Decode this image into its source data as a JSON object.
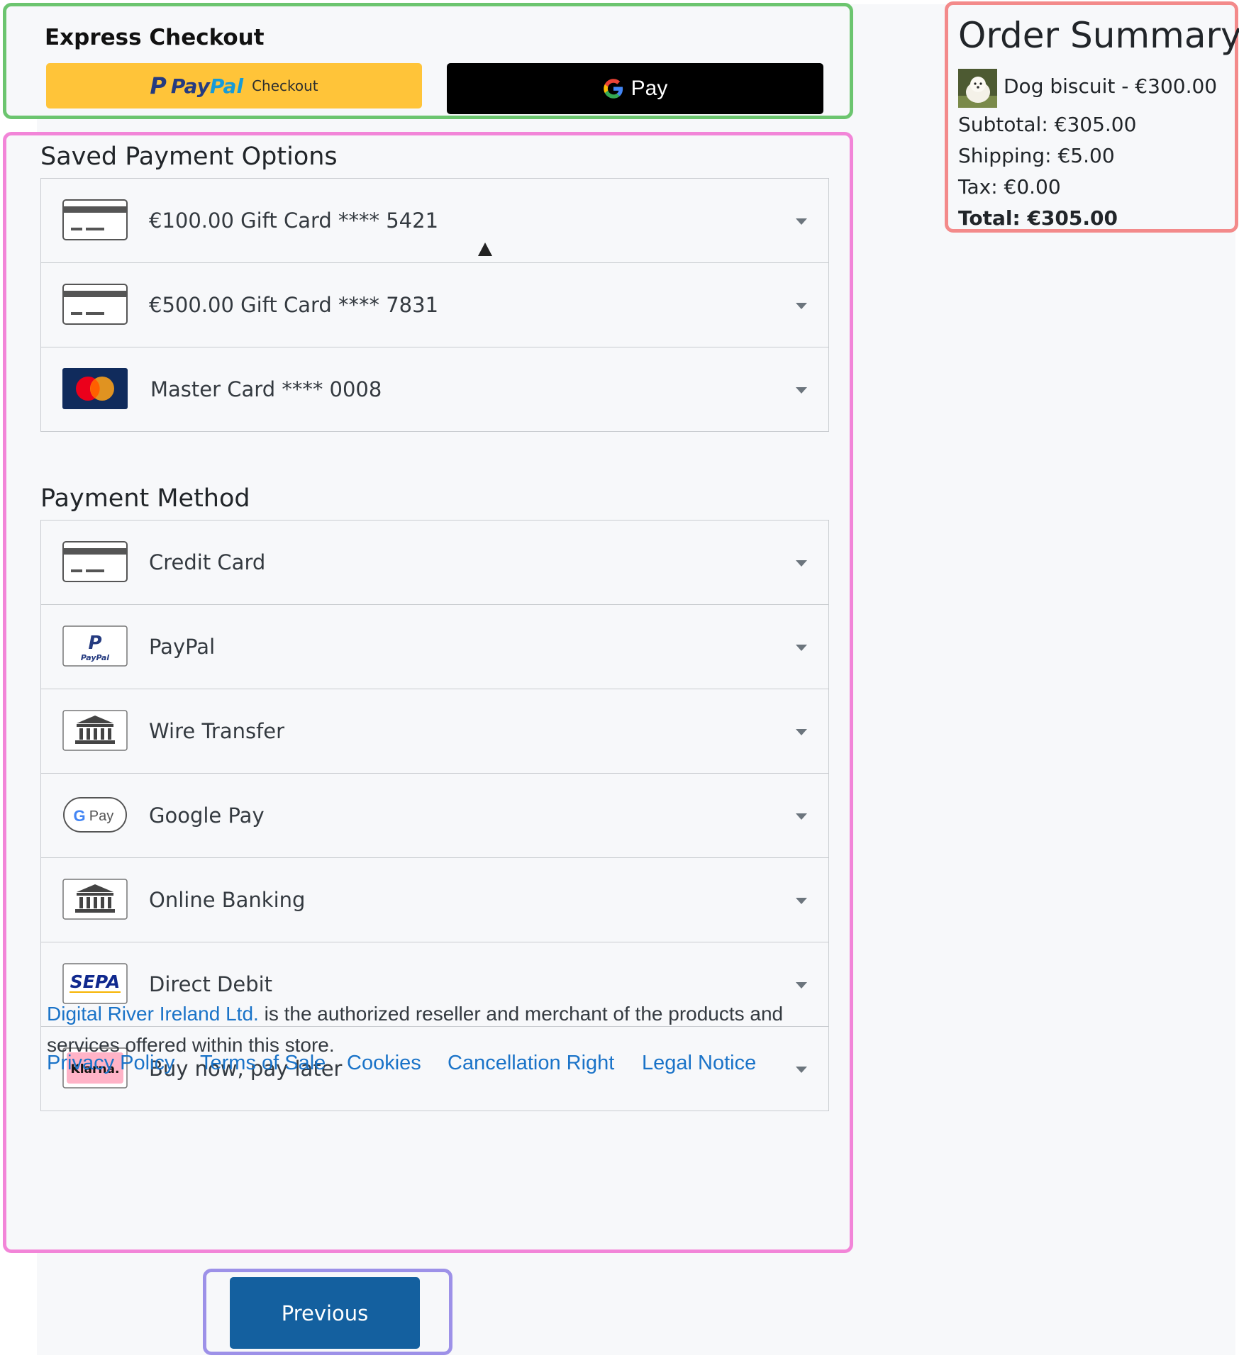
{
  "express": {
    "title": "Express Checkout",
    "paypal_p": "P",
    "paypal_pay": "Pay",
    "paypal_pal": "Pal",
    "paypal_checkout": "Checkout",
    "gpay_label": "Pay"
  },
  "saved": {
    "title": "Saved Payment Options",
    "items": [
      {
        "label": "€100.00 Gift Card **** 5421",
        "icon": "gift-card-icon"
      },
      {
        "label": "€500.00 Gift Card **** 7831",
        "icon": "gift-card-icon"
      },
      {
        "label": "Master Card **** 0008",
        "icon": "mastercard-icon"
      }
    ]
  },
  "methods": {
    "title": "Payment Method",
    "items": [
      {
        "label": "Credit Card",
        "icon": "credit-card-icon"
      },
      {
        "label": "PayPal",
        "icon": "paypal-icon"
      },
      {
        "label": "Wire Transfer",
        "icon": "bank-icon"
      },
      {
        "label": "Google Pay",
        "icon": "google-pay-icon"
      },
      {
        "label": "Online Banking",
        "icon": "bank-icon"
      },
      {
        "label": "Direct Debit",
        "icon": "sepa-icon"
      },
      {
        "label": "Buy now, pay later",
        "icon": "klarna-icon"
      }
    ]
  },
  "icons": {
    "gpay_badge": "Pay",
    "sepa": "SEPA",
    "klarna": "Klarna.",
    "paypal_small": "PayPal"
  },
  "legal": {
    "merchant_link": "Digital River Ireland Ltd.",
    "text": " is the authorized reseller and merchant of the products and services offered within this store.",
    "links": [
      "Privacy Policy",
      "Terms of Sale",
      "Cookies",
      "Cancellation Right",
      "Legal Notice"
    ]
  },
  "nav": {
    "previous": "Previous"
  },
  "summary": {
    "title": "Order Summary",
    "item": "Dog biscuit - €300.00",
    "subtotal": "Subtotal: €305.00",
    "shipping": "Shipping: €5.00",
    "tax": "Tax: €0.00",
    "total": "Total: €305.00"
  },
  "colors": {
    "paypal_yellow": "#ffc439",
    "link_blue": "#1a73c8",
    "primary_button": "#14609f"
  }
}
